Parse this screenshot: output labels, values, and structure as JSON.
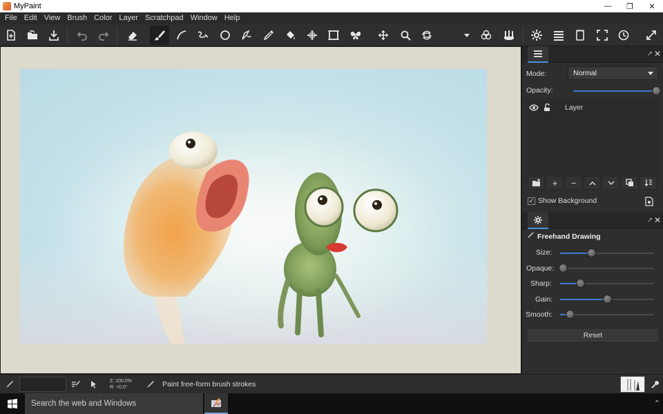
{
  "window": {
    "title": "MyPaint",
    "controls": [
      "—",
      "❐",
      "✕"
    ]
  },
  "menu": [
    "File",
    "Edit",
    "View",
    "Brush",
    "Color",
    "Layer",
    "Scratchpad",
    "Window",
    "Help"
  ],
  "layers_panel": {
    "mode_label": "Mode:",
    "mode_value": "Normal",
    "opacity_label": "Opacity:",
    "opacity_value": 1.0,
    "layers": [
      {
        "name": "Layer",
        "visible": true,
        "locked": false
      }
    ],
    "show_background_label": "Show Background",
    "show_background_checked": true
  },
  "brush_panel": {
    "title": "Freehand Drawing",
    "settings": [
      {
        "label": "Size:",
        "value": 0.33
      },
      {
        "label": "Opaque:",
        "value": 0.0
      },
      {
        "label": "Sharp:",
        "value": 0.21
      },
      {
        "label": "Gain:",
        "value": 0.5
      },
      {
        "label": "Smooth:",
        "value": 0.1
      }
    ],
    "reset_label": "Reset"
  },
  "status": {
    "zoom_line": "Z: 100.0%",
    "rotation_line": "R: +0.0°",
    "message": "Paint free-form brush strokes"
  },
  "taskbar": {
    "search_placeholder": "Search the web and Windows"
  },
  "colors": {
    "accent": "#3d7ad1",
    "panel_bg": "#2e2e2e",
    "canvas_bg": "#dcd9cd"
  }
}
